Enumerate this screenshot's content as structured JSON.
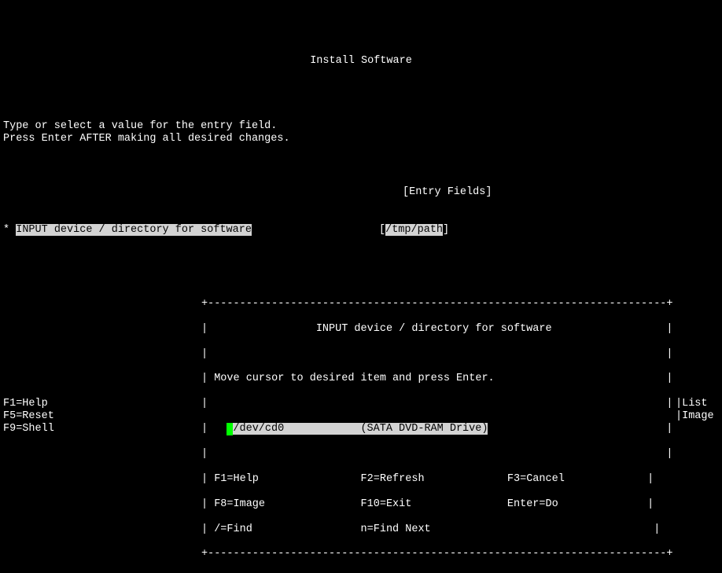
{
  "title": "Install Software",
  "instructions": {
    "line1": "Type or select a value for the entry field.",
    "line2": "Press Enter AFTER making all desired changes."
  },
  "entry_fields_header": "[Entry Fields]",
  "input_row": {
    "marker": "*",
    "label": "INPUT device / directory for software",
    "bracket_open": "[",
    "value": "/tmp/path",
    "bracket_close": "]"
  },
  "popup": {
    "title": "INPUT device / directory for software",
    "instruction": "Move cursor to desired item and press Enter.",
    "selected": {
      "device": "/dev/cd0",
      "description": "(SATA DVD-RAM Drive)"
    },
    "fkeys": {
      "f1": "F1=Help",
      "f2": "F2=Refresh",
      "f3": "F3=Cancel",
      "f8": "F8=Image",
      "f10": "F10=Exit",
      "enter": "Enter=Do",
      "find": "/=Find",
      "findnext": "n=Find Next"
    }
  },
  "bottom_fkeys": {
    "f1": "F1=Help",
    "f5": "F5=Reset",
    "f9": "F9=Shell"
  },
  "right_labels": {
    "list": "List",
    "image": "Image"
  },
  "border": {
    "top": "+------------------------------------------------------------------------+",
    "bot": "+------------------------------------------------------------------------+"
  }
}
